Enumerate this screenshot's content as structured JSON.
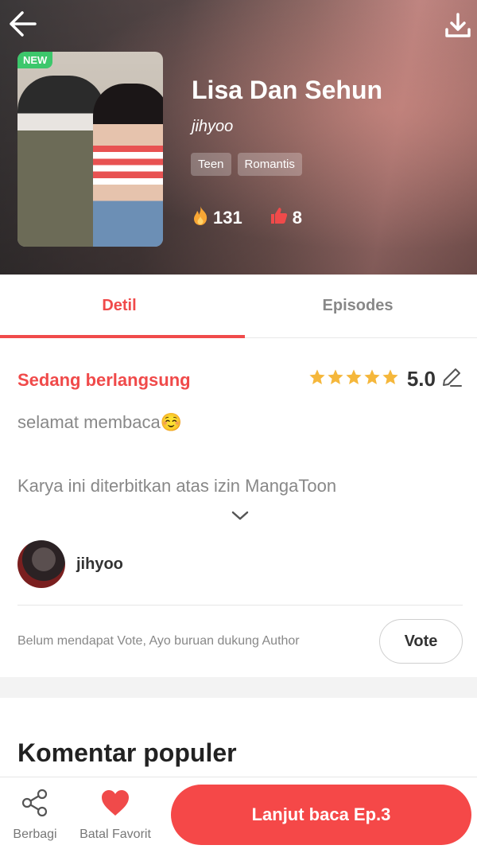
{
  "header": {
    "badge": "NEW",
    "title": "Lisa Dan Sehun",
    "author": "jihyoo",
    "tags": [
      "Teen",
      "Romantis"
    ],
    "popularity": "131",
    "likes": "8"
  },
  "tabs": [
    {
      "label": "Detil",
      "active": true
    },
    {
      "label": "Episodes",
      "active": false
    }
  ],
  "detail": {
    "status": "Sedang berlangsung",
    "rating": "5.0",
    "stars": 5,
    "description": "selamat membaca☺️",
    "notice": "Karya ini diterbitkan atas izin MangaToon"
  },
  "author": {
    "name": "jihyoo"
  },
  "vote": {
    "message": "Belum mendapat Vote, Ayo buruan dukung Author",
    "button": "Vote"
  },
  "comments": {
    "title": "Komentar populer"
  },
  "bottom": {
    "share_label": "Berbagi",
    "favorite_label": "Batal Favorit",
    "continue_label": "Lanjut baca Ep.3"
  },
  "colors": {
    "accent": "#f04a4a",
    "new_badge": "#3cc76b",
    "star": "#f5b73b"
  },
  "icons": [
    "back-arrow-icon",
    "download-icon",
    "fire-icon",
    "thumbs-up-icon",
    "star-icon",
    "edit-icon",
    "chevron-down-icon",
    "share-icon",
    "heart-icon"
  ]
}
